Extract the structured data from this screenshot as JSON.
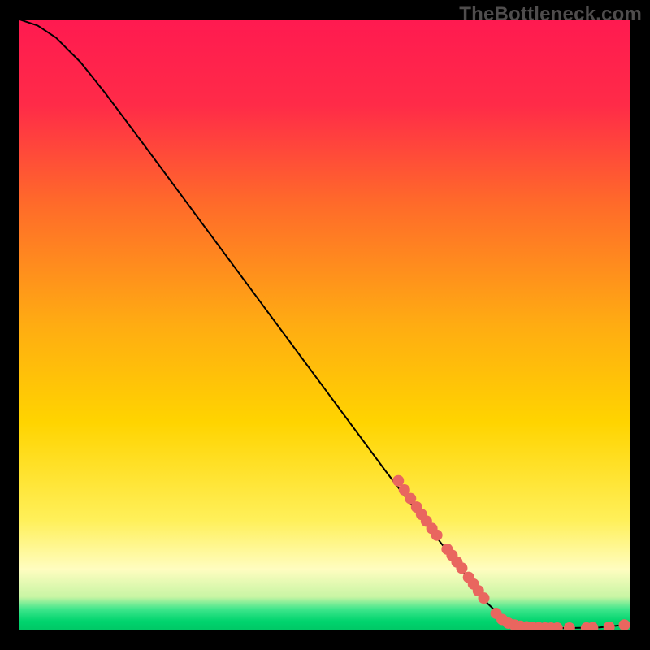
{
  "watermark": "TheBottleneck.com",
  "colors": {
    "top_gradient": "#ff1a50",
    "mid_gradient": "#ffd400",
    "lowlight": "#fff7a0",
    "green_band": "#00e076",
    "curve": "#000000",
    "dot": "#e9665f",
    "frame": "#000000"
  },
  "chart_data": {
    "type": "line",
    "title": "",
    "xlabel": "",
    "ylabel": "",
    "xlim": [
      0,
      100
    ],
    "ylim": [
      0,
      100
    ],
    "curve": [
      {
        "x": 0,
        "y": 100
      },
      {
        "x": 3,
        "y": 99
      },
      {
        "x": 6,
        "y": 97
      },
      {
        "x": 10,
        "y": 93
      },
      {
        "x": 14,
        "y": 88
      },
      {
        "x": 20,
        "y": 80
      },
      {
        "x": 30,
        "y": 66.5
      },
      {
        "x": 40,
        "y": 53
      },
      {
        "x": 50,
        "y": 39.5
      },
      {
        "x": 60,
        "y": 26
      },
      {
        "x": 70,
        "y": 13
      },
      {
        "x": 76,
        "y": 5
      },
      {
        "x": 80,
        "y": 1.2
      },
      {
        "x": 84,
        "y": 0.4
      },
      {
        "x": 90,
        "y": 0.4
      },
      {
        "x": 95,
        "y": 0.5
      },
      {
        "x": 100,
        "y": 1.0
      }
    ],
    "dots": [
      {
        "x": 62,
        "y": 24.5
      },
      {
        "x": 63,
        "y": 23.0
      },
      {
        "x": 64,
        "y": 21.6
      },
      {
        "x": 65,
        "y": 20.2
      },
      {
        "x": 65.8,
        "y": 19.0
      },
      {
        "x": 66.6,
        "y": 17.9
      },
      {
        "x": 67.5,
        "y": 16.7
      },
      {
        "x": 68.3,
        "y": 15.6
      },
      {
        "x": 70.0,
        "y": 13.3
      },
      {
        "x": 70.8,
        "y": 12.3
      },
      {
        "x": 71.6,
        "y": 11.2
      },
      {
        "x": 72.4,
        "y": 10.2
      },
      {
        "x": 73.5,
        "y": 8.7
      },
      {
        "x": 74.3,
        "y": 7.6
      },
      {
        "x": 75.1,
        "y": 6.5
      },
      {
        "x": 76.0,
        "y": 5.3
      },
      {
        "x": 78.0,
        "y": 2.8
      },
      {
        "x": 79.0,
        "y": 1.8
      },
      {
        "x": 80.0,
        "y": 1.2
      },
      {
        "x": 81.0,
        "y": 0.9
      },
      {
        "x": 82.0,
        "y": 0.7
      },
      {
        "x": 83.0,
        "y": 0.6
      },
      {
        "x": 84.0,
        "y": 0.5
      },
      {
        "x": 85.0,
        "y": 0.45
      },
      {
        "x": 86.0,
        "y": 0.42
      },
      {
        "x": 87.0,
        "y": 0.4
      },
      {
        "x": 88.0,
        "y": 0.4
      },
      {
        "x": 90.0,
        "y": 0.4
      },
      {
        "x": 92.8,
        "y": 0.42
      },
      {
        "x": 93.8,
        "y": 0.45
      },
      {
        "x": 96.5,
        "y": 0.55
      },
      {
        "x": 99.0,
        "y": 0.9
      }
    ],
    "gradient_stops": [
      {
        "offset": 0,
        "color": "#ff1a50"
      },
      {
        "offset": 0.14,
        "color": "#ff2b48"
      },
      {
        "offset": 0.3,
        "color": "#ff6a2a"
      },
      {
        "offset": 0.5,
        "color": "#ffac12"
      },
      {
        "offset": 0.66,
        "color": "#ffd400"
      },
      {
        "offset": 0.82,
        "color": "#fff05a"
      },
      {
        "offset": 0.9,
        "color": "#fffdc0"
      },
      {
        "offset": 0.945,
        "color": "#c8f5a4"
      },
      {
        "offset": 0.965,
        "color": "#3fe68c"
      },
      {
        "offset": 0.985,
        "color": "#00d46e"
      },
      {
        "offset": 1.0,
        "color": "#00c765"
      }
    ]
  }
}
